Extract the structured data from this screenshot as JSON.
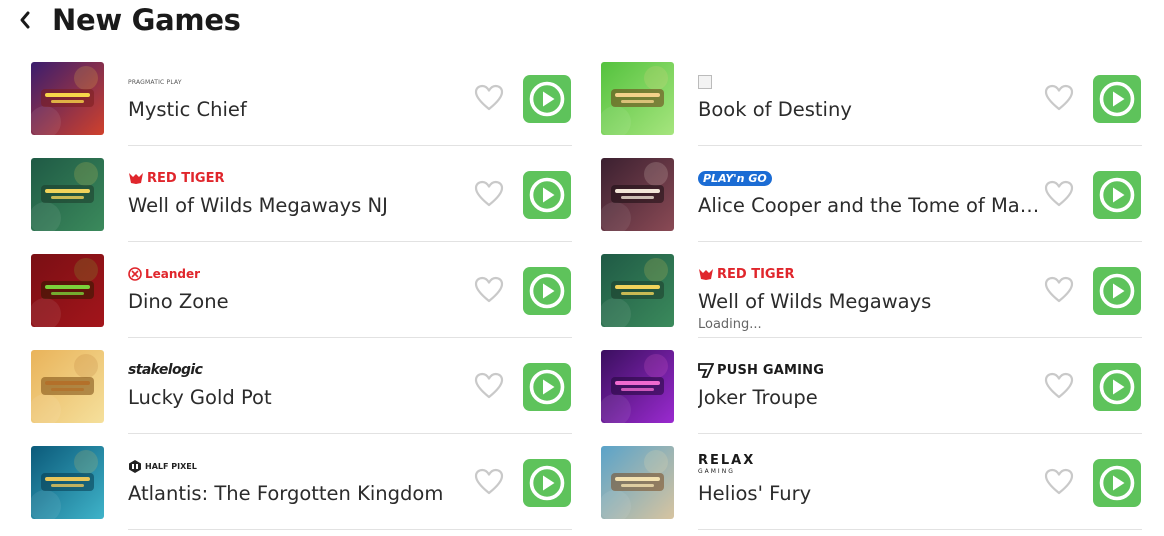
{
  "header": {
    "title": "New Games",
    "back_icon": "chevron-left-icon"
  },
  "colors": {
    "play_button": "#5ec35b",
    "separator": "#e2e2e2",
    "heart_outline": "#c9c9c9",
    "red_tiger": "#e0262c"
  },
  "left_column": [
    {
      "name": "Mystic Chief",
      "provider": "PRAGMATIC PLAY",
      "provider_style": "pragmatic",
      "thumb_text": "MYSTIC CHIEF",
      "thumb_theme": "mystic"
    },
    {
      "name": "Well of Wilds Megaways NJ",
      "provider": "RED TIGER",
      "provider_style": "redtiger",
      "thumb_text": "Well of Wilds",
      "thumb_theme": "wells"
    },
    {
      "name": "Dino Zone",
      "provider": "Leander",
      "provider_style": "leander",
      "thumb_text": "DINO ZONE",
      "thumb_theme": "dino"
    },
    {
      "name": "Lucky Gold Pot",
      "provider": "stakelogic",
      "provider_style": "stake",
      "thumb_text": "Lucky Gold Pot",
      "thumb_theme": "gold"
    },
    {
      "name": "Atlantis: The Forgotten Kingdom",
      "provider": "HALF PIXEL",
      "provider_style": "halfpixel",
      "thumb_text": "ATLANTIS",
      "thumb_theme": "atlantis"
    }
  ],
  "right_column": [
    {
      "name": "Book of Destiny",
      "provider": "",
      "provider_style": "broken",
      "thumb_text": "BOOK OF DESTINY",
      "thumb_theme": "book"
    },
    {
      "name": "Alice Cooper and the Tome of Mad…",
      "provider": "PLAY'n GO",
      "provider_style": "playngo",
      "thumb_text": "ALICE COOPER",
      "thumb_theme": "alice"
    },
    {
      "name": "Well of Wilds Megaways",
      "provider": "RED TIGER",
      "provider_style": "redtiger",
      "thumb_text": "Well of Wilds",
      "thumb_theme": "wells",
      "status": "Loading..."
    },
    {
      "name": "Joker Troupe",
      "provider": "PUSH GAMING",
      "provider_style": "push",
      "thumb_text": "JOKER TROUPE",
      "thumb_theme": "joker"
    },
    {
      "name": "Helios' Fury",
      "provider": "RELAX",
      "provider_sub": "GAMING",
      "provider_style": "relax",
      "thumb_text": "HELIOS FURY",
      "thumb_theme": "helios"
    }
  ]
}
